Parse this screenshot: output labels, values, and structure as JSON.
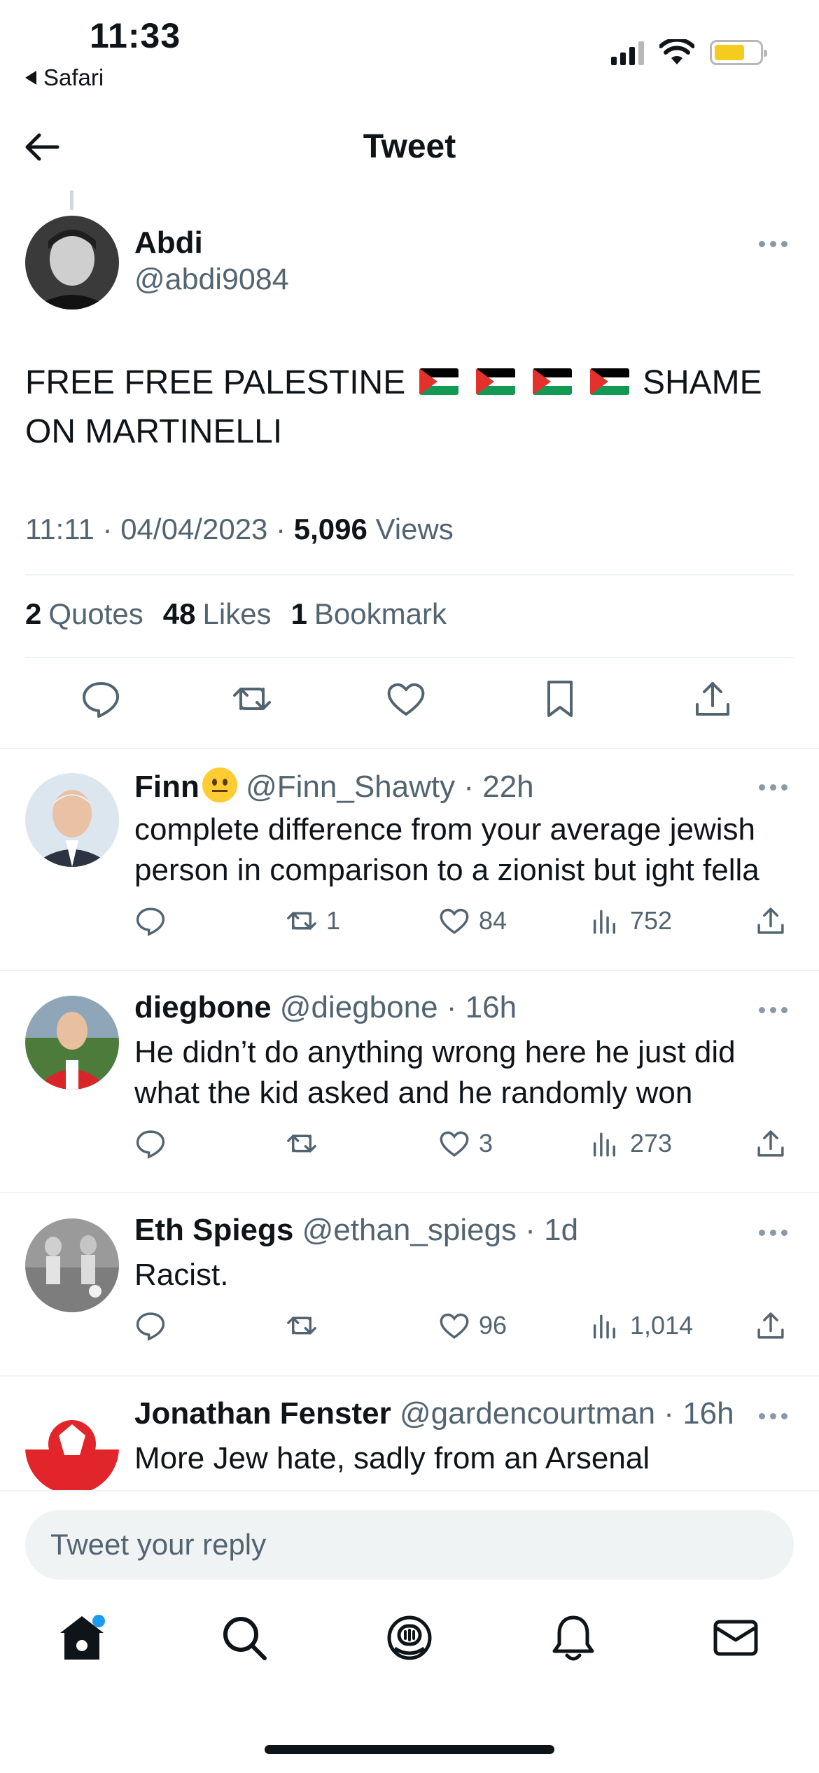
{
  "status": {
    "time": "11:33",
    "back_app": "Safari"
  },
  "header": {
    "title": "Tweet"
  },
  "tweet": {
    "name": "Abdi",
    "handle": "@abdi9084",
    "text_part1": "FREE FREE PALESTINE",
    "text_part2": "SHAME ON MARTINELLI",
    "time": "11:11",
    "date": "04/04/2023",
    "views_count": "5,096",
    "views_label": "Views",
    "quotes_count": "2",
    "quotes_label": "Quotes",
    "likes_count": "48",
    "likes_label": "Likes",
    "bookmarks_count": "1",
    "bookmarks_label": "Bookmark"
  },
  "replies": [
    {
      "name": "Finn",
      "handle": "@Finn_Shawty",
      "age": "22h",
      "text": "complete difference from your average jewish person in comparison to a zionist but ight fella",
      "retweets": "1",
      "likes": "84",
      "views": "752"
    },
    {
      "name": "diegbone",
      "handle": "@diegbone",
      "age": "16h",
      "text": "He didn’t do anything wrong here he just did what the kid asked and he randomly won",
      "retweets": "",
      "likes": "3",
      "views": "273"
    },
    {
      "name": "Eth Spiegs",
      "handle": "@ethan_spiegs",
      "age": "1d",
      "text": "Racist.",
      "retweets": "",
      "likes": "96",
      "views": "1,014"
    },
    {
      "name": "Jonathan Fenster",
      "handle": "@gardencourtman",
      "age": "16h",
      "text": "More Jew hate, sadly from an Arsenal",
      "retweets": "",
      "likes": "",
      "views": ""
    }
  ],
  "reply_bar": {
    "placeholder": "Tweet your reply"
  },
  "colors": {
    "accent": "#1d9bf0",
    "text": "#0f1419",
    "muted": "#536471"
  }
}
